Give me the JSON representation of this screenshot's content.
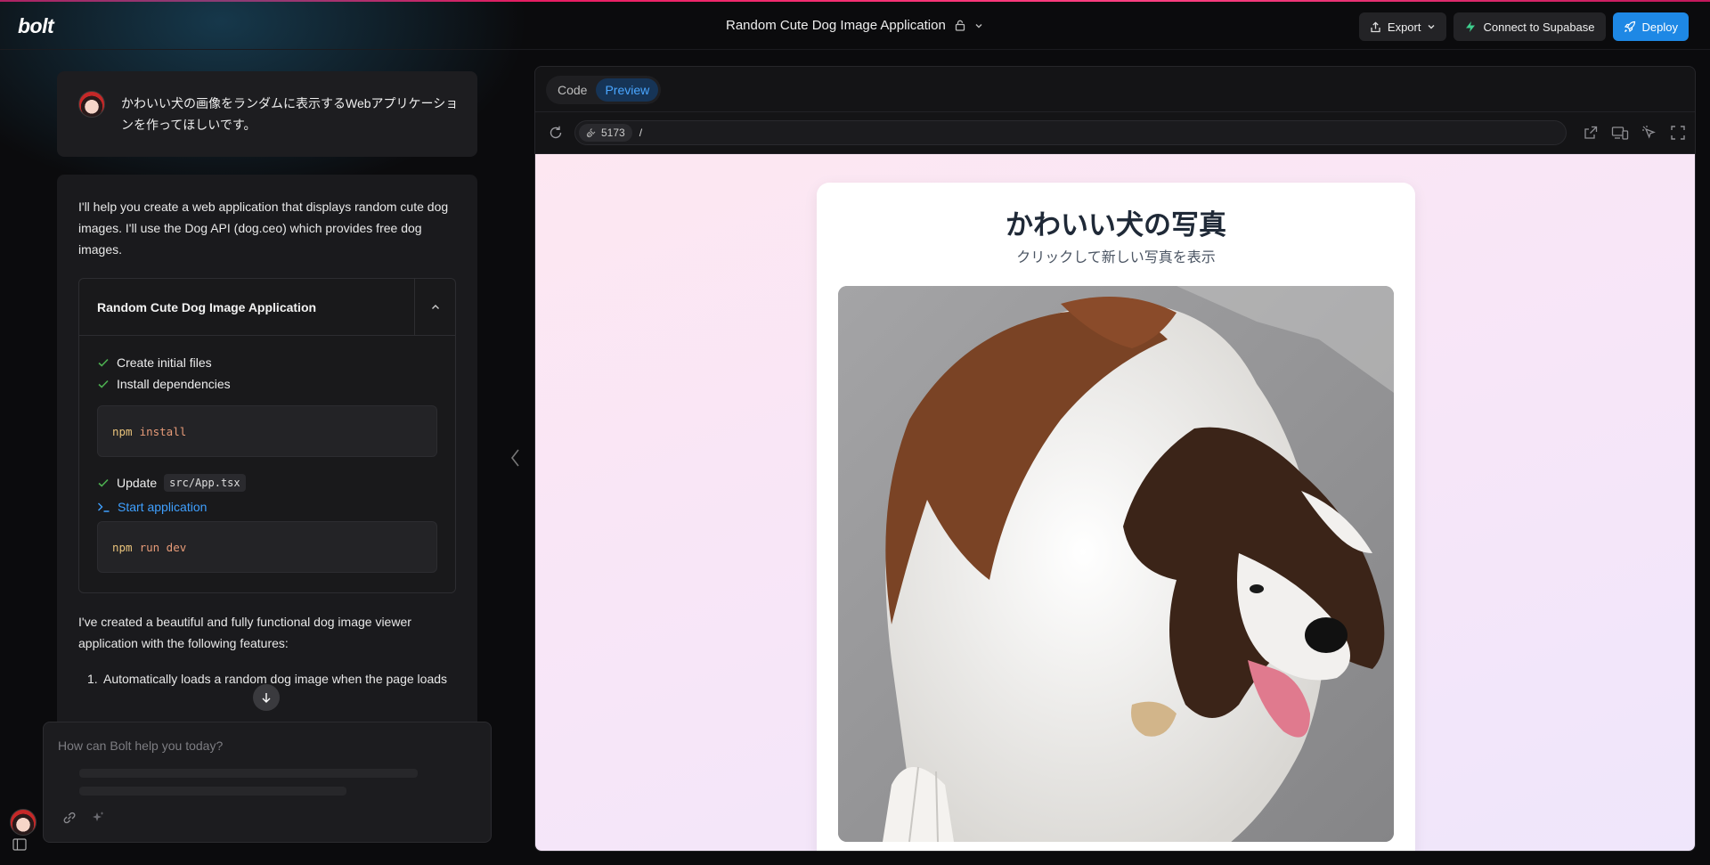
{
  "app": {
    "logo": "bolt",
    "project_title": "Random Cute Dog Image Application"
  },
  "header": {
    "export_label": "Export",
    "supabase_label": "Connect to Supabase",
    "deploy_label": "Deploy"
  },
  "colors": {
    "accent": "#1e88e5",
    "tab_active": "#4aa6ff",
    "check": "#4caf50",
    "top_line": "#e91e63"
  },
  "chat": {
    "user_message": "かわいい犬の画像をランダムに表示するWebアプリケーションを作ってほしいです。",
    "assistant_intro": "I'll help you create a web application that displays random cute dog images. I'll use the Dog API (dog.ceo) which provides free dog images.",
    "artifact": {
      "title": "Random Cute Dog Image Application",
      "steps": [
        {
          "label": "Create initial files",
          "status": "done"
        },
        {
          "label": "Install dependencies",
          "status": "done"
        },
        {
          "label": "Update",
          "file": "src/App.tsx",
          "status": "done"
        },
        {
          "label": "Start application",
          "status": "running"
        }
      ],
      "commands": [
        {
          "cmd": "npm",
          "args": "install"
        },
        {
          "cmd": "npm",
          "args": "run dev"
        }
      ]
    },
    "assistant_summary": "I've created a beautiful and fully functional dog image viewer application with the following features:",
    "features": [
      {
        "num": "1.",
        "text": "Automatically loads a random dog image when the page loads"
      }
    ]
  },
  "input": {
    "placeholder": "How can Bolt help you today?"
  },
  "preview": {
    "tabs": [
      {
        "label": "Code",
        "active": false
      },
      {
        "label": "Preview",
        "active": true
      }
    ],
    "port": "5173",
    "path": "/",
    "app_title": "かわいい犬の写真",
    "app_subtitle": "クリックして新しい写真を表示"
  }
}
